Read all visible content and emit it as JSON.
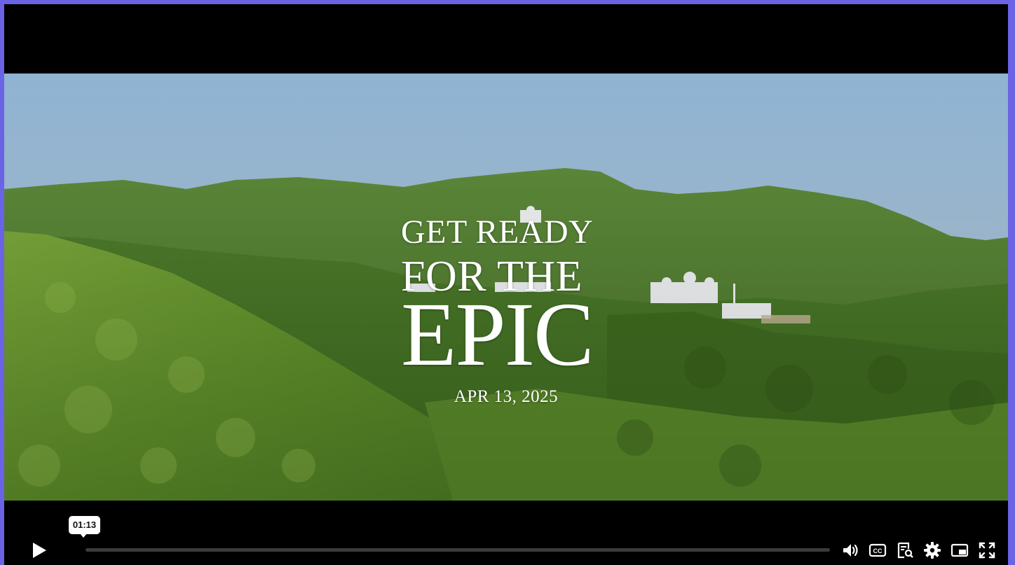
{
  "video": {
    "title_line1": "GET READY",
    "title_line2": "FOR THE",
    "title_line3": "EPIC",
    "date": "APR 13, 2025"
  },
  "controls": {
    "hover_time": "01:13",
    "progress_fraction": 0.0,
    "icons": [
      "play-icon",
      "volume-icon",
      "closed-captions-icon",
      "transcript-icon",
      "settings-gear-icon",
      "picture-in-picture-icon",
      "fullscreen-icon"
    ]
  }
}
